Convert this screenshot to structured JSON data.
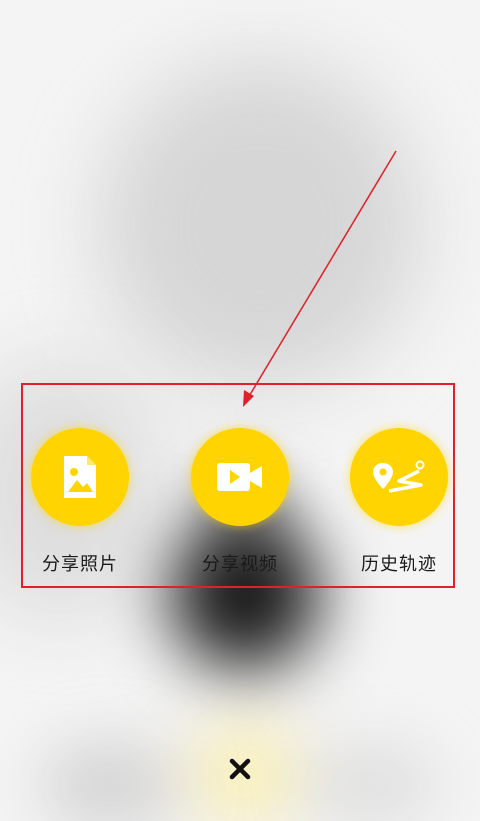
{
  "menu": {
    "items": [
      {
        "label": "分享照片",
        "icon": "photo-share-icon"
      },
      {
        "label": "分享视频",
        "icon": "video-share-icon"
      },
      {
        "label": "历史轨迹",
        "icon": "route-history-icon"
      }
    ]
  },
  "close": {
    "icon": "close-icon"
  },
  "colors": {
    "accent": "#ffd400",
    "highlight": "#e0202a"
  }
}
